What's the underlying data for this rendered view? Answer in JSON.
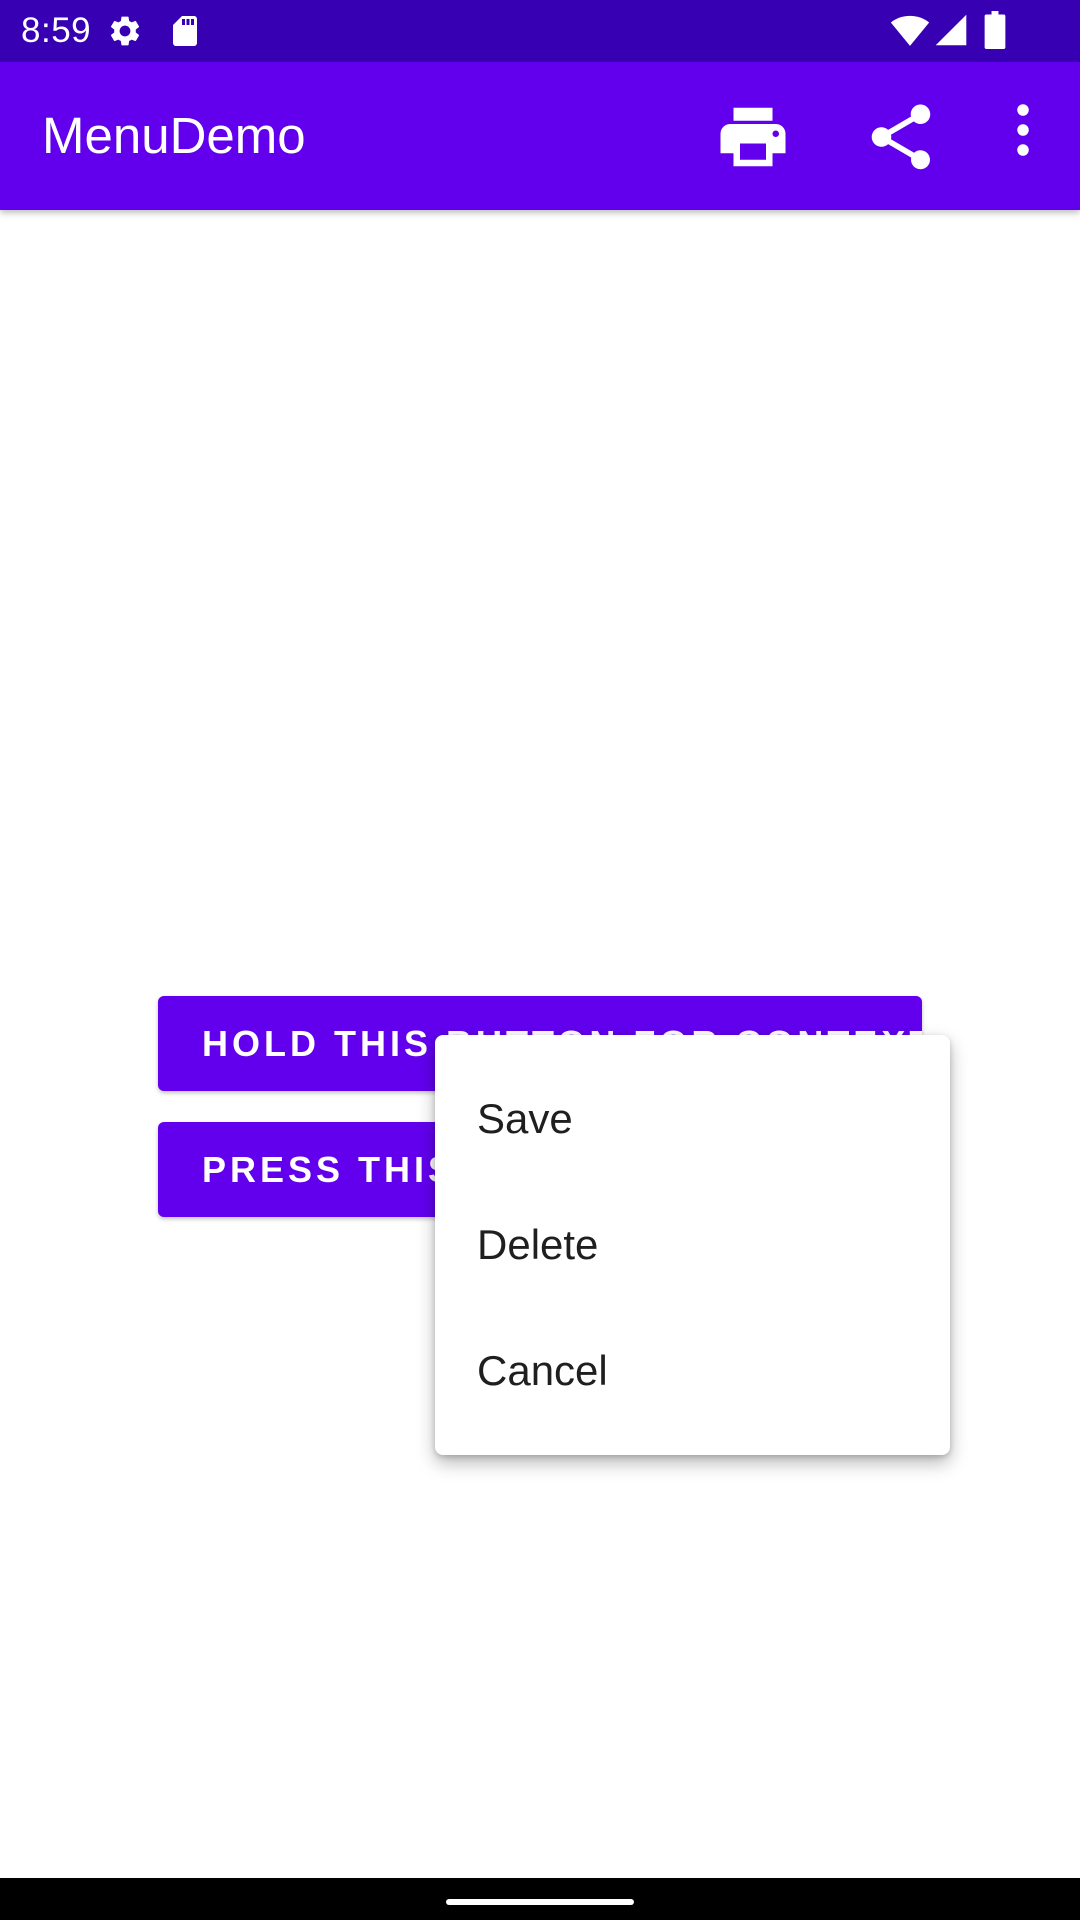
{
  "status_bar": {
    "time": "8:59",
    "icons": [
      "settings-icon",
      "sd-card-icon",
      "wifi-icon",
      "signal-icon",
      "battery-icon"
    ],
    "background": "#3700b3"
  },
  "app_bar": {
    "title": "MenuDemo",
    "background": "#6200ee",
    "actions": [
      "print-icon",
      "share-icon",
      "more-vert-icon"
    ]
  },
  "main": {
    "hold_button_label": "HOLD THIS BUTTON FOR CONTEXT",
    "press_button_label": "PRESS THIS BUTTON FOR POPUP",
    "button_color": "#6200ee"
  },
  "context_menu": {
    "items": [
      {
        "label": "Save"
      },
      {
        "label": "Delete"
      },
      {
        "label": "Cancel"
      }
    ]
  },
  "nav_bar": {
    "background": "#000000"
  }
}
